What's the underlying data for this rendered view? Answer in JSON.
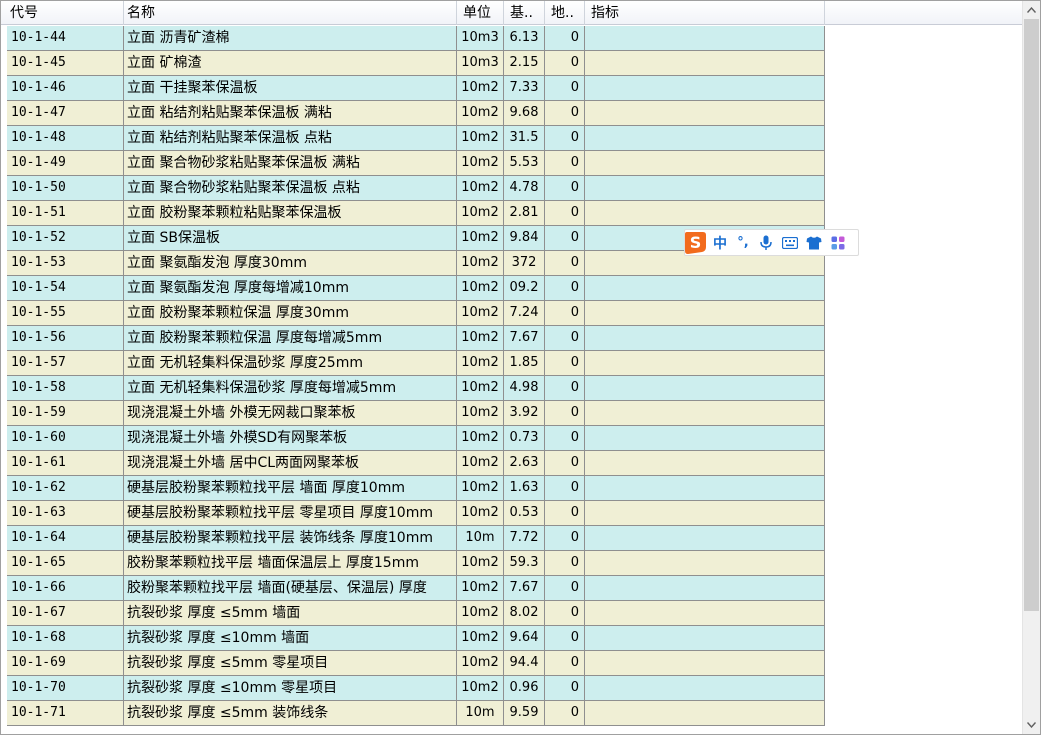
{
  "columns": {
    "code": "代号",
    "name": "名称",
    "unit": "单位",
    "base": "基..",
    "land": "地..",
    "index": "指标"
  },
  "rows": [
    {
      "code": "10-1-44",
      "name": "立面 沥青矿渣棉",
      "unit": "10m3",
      "base": "6.13",
      "land": "0"
    },
    {
      "code": "10-1-45",
      "name": "立面 矿棉渣",
      "unit": "10m3",
      "base": "2.15",
      "land": "0"
    },
    {
      "code": "10-1-46",
      "name": "立面 干挂聚苯保温板",
      "unit": "10m2",
      "base": "7.33",
      "land": "0"
    },
    {
      "code": "10-1-47",
      "name": "立面 粘结剂粘贴聚苯保温板 满粘",
      "unit": "10m2",
      "base": "9.68",
      "land": "0"
    },
    {
      "code": "10-1-48",
      "name": "立面 粘结剂粘贴聚苯保温板 点粘",
      "unit": "10m2",
      "base": "31.5",
      "land": "0"
    },
    {
      "code": "10-1-49",
      "name": "立面 聚合物砂浆粘贴聚苯保温板 满粘",
      "unit": "10m2",
      "base": "5.53",
      "land": "0"
    },
    {
      "code": "10-1-50",
      "name": "立面 聚合物砂浆粘贴聚苯保温板 点粘",
      "unit": "10m2",
      "base": "4.78",
      "land": "0"
    },
    {
      "code": "10-1-51",
      "name": "立面 胶粉聚苯颗粒粘贴聚苯保温板",
      "unit": "10m2",
      "base": "2.81",
      "land": "0"
    },
    {
      "code": "10-1-52",
      "name": "立面 SB保温板",
      "unit": "10m2",
      "base": "9.84",
      "land": "0"
    },
    {
      "code": "10-1-53",
      "name": "立面 聚氨酯发泡 厚度30mm",
      "unit": "10m2",
      "base": "372",
      "land": "0"
    },
    {
      "code": "10-1-54",
      "name": "立面 聚氨酯发泡 厚度每增减10mm",
      "unit": "10m2",
      "base": "09.2",
      "land": "0"
    },
    {
      "code": "10-1-55",
      "name": "立面 胶粉聚苯颗粒保温 厚度30mm",
      "unit": "10m2",
      "base": "7.24",
      "land": "0"
    },
    {
      "code": "10-1-56",
      "name": "立面 胶粉聚苯颗粒保温 厚度每增减5mm",
      "unit": "10m2",
      "base": "7.67",
      "land": "0"
    },
    {
      "code": "10-1-57",
      "name": "立面 无机轻集料保温砂浆 厚度25mm",
      "unit": "10m2",
      "base": "1.85",
      "land": "0"
    },
    {
      "code": "10-1-58",
      "name": "立面 无机轻集料保温砂浆 厚度每增减5mm",
      "unit": "10m2",
      "base": "4.98",
      "land": "0"
    },
    {
      "code": "10-1-59",
      "name": "现浇混凝土外墙 外模无网裁口聚苯板",
      "unit": "10m2",
      "base": "3.92",
      "land": "0"
    },
    {
      "code": "10-1-60",
      "name": "现浇混凝土外墙 外模SD有网聚苯板",
      "unit": "10m2",
      "base": "0.73",
      "land": "0"
    },
    {
      "code": "10-1-61",
      "name": "现浇混凝土外墙 居中CL两面网聚苯板",
      "unit": "10m2",
      "base": "2.63",
      "land": "0"
    },
    {
      "code": "10-1-62",
      "name": "硬基层胶粉聚苯颗粒找平层 墙面 厚度10mm",
      "unit": "10m2",
      "base": "1.63",
      "land": "0"
    },
    {
      "code": "10-1-63",
      "name": "硬基层胶粉聚苯颗粒找平层 零星项目 厚度10mm",
      "unit": "10m2",
      "base": "0.53",
      "land": "0"
    },
    {
      "code": "10-1-64",
      "name": "硬基层胶粉聚苯颗粒找平层 装饰线条 厚度10mm",
      "unit": "10m",
      "base": "7.72",
      "land": "0"
    },
    {
      "code": "10-1-65",
      "name": "胶粉聚苯颗粒找平层 墙面保温层上 厚度15mm",
      "unit": "10m2",
      "base": "59.3",
      "land": "0"
    },
    {
      "code": "10-1-66",
      "name": "胶粉聚苯颗粒找平层 墙面(硬基层、保温层) 厚度",
      "unit": "10m2",
      "base": "7.67",
      "land": "0"
    },
    {
      "code": "10-1-67",
      "name": "抗裂砂浆  厚度 ≤5mm 墙面",
      "unit": "10m2",
      "base": "8.02",
      "land": "0"
    },
    {
      "code": "10-1-68",
      "name": "抗裂砂浆  厚度 ≤10mm 墙面",
      "unit": "10m2",
      "base": "9.64",
      "land": "0"
    },
    {
      "code": "10-1-69",
      "name": "抗裂砂浆  厚度 ≤5mm 零星项目",
      "unit": "10m2",
      "base": "94.4",
      "land": "0"
    },
    {
      "code": "10-1-70",
      "name": "抗裂砂浆  厚度 ≤10mm 零星项目",
      "unit": "10m2",
      "base": "0.96",
      "land": "0"
    },
    {
      "code": "10-1-71",
      "name": "抗裂砂浆  厚度 ≤5mm 装饰线条",
      "unit": "10m",
      "base": "9.59",
      "land": "0"
    }
  ],
  "ime": {
    "logo_letter": "S",
    "lang_label": "中",
    "punct_label": "°,",
    "icons": [
      "sogou-logo-icon",
      "mic-icon",
      "keyboard-icon",
      "tshirt-skin-icon",
      "apps-grid-icon"
    ]
  },
  "colors": {
    "row_even": "#cdeeee",
    "row_odd": "#f0efd5",
    "ime_accent": "#1b6fd1",
    "ime_logo": "#f26b1d"
  }
}
